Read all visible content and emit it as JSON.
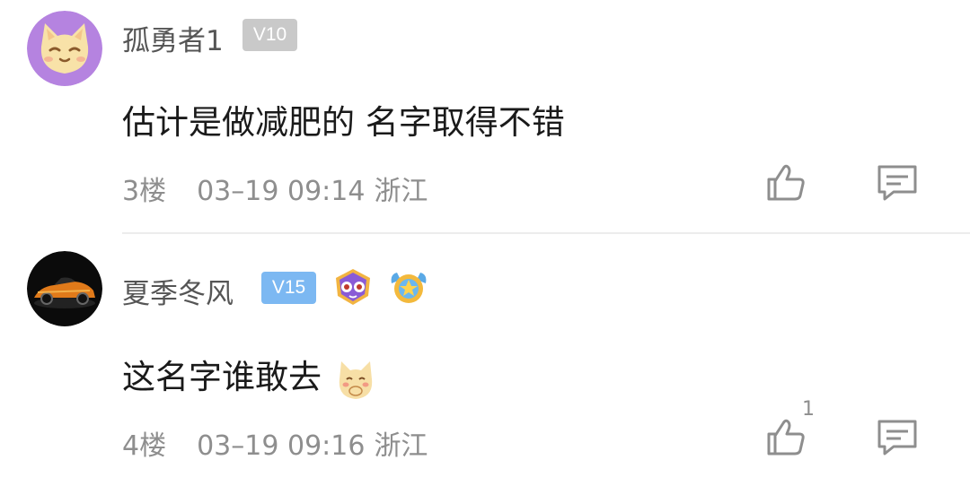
{
  "comments": [
    {
      "username": "孤勇者1",
      "level": "V10",
      "text": "估计是做减肥的 名字取得不错",
      "floor": "3楼",
      "datetime": "03–19 09:14",
      "location": "浙江",
      "likes": "",
      "avatar_icon": "cat-emoji-avatar",
      "level_color": "#c9c9c9"
    },
    {
      "username": "夏季冬风",
      "level": "V15",
      "text": "这名字谁敢去",
      "emoji": "shy-cat-emoji",
      "floor": "4楼",
      "datetime": "03–19 09:16",
      "location": "浙江",
      "likes": "1",
      "avatar_icon": "sports-car-avatar",
      "level_color": "#7cb8f2",
      "badges": [
        "owl-mask-badge",
        "gold-star-badge"
      ]
    }
  ],
  "icons": {
    "like": "thumbs-up-icon",
    "reply": "comment-bubble-icon"
  }
}
